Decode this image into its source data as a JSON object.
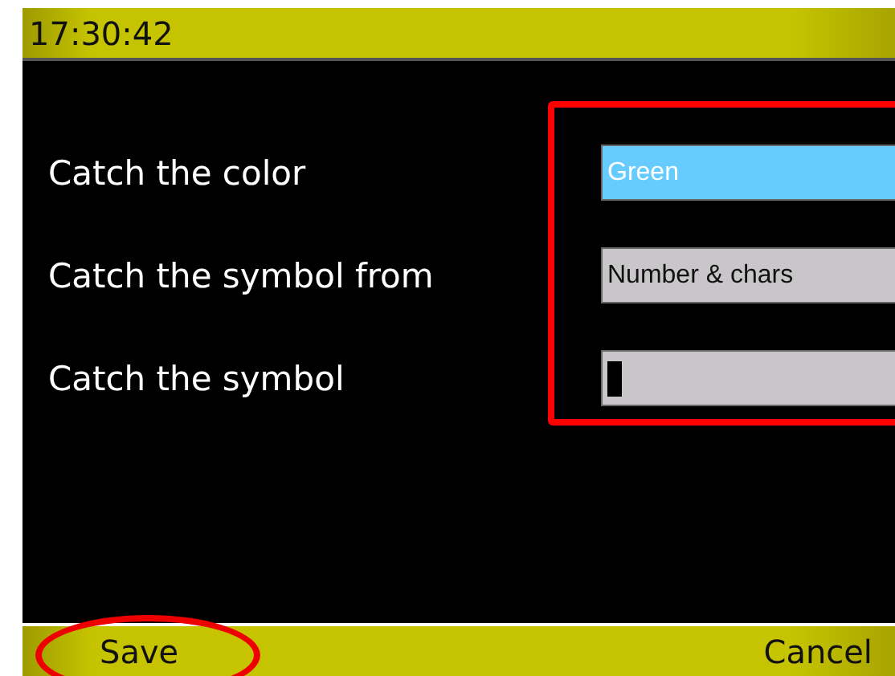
{
  "status_bar": {
    "time": "17:30:42"
  },
  "fields": [
    {
      "label": "Catch the color",
      "kind": "select",
      "value": "Green",
      "selected": true
    },
    {
      "label": "Catch the symbol from",
      "kind": "select",
      "value": "Number & chars",
      "selected": false
    },
    {
      "label": "Catch the symbol",
      "kind": "text",
      "selected": false
    }
  ],
  "softkeys": {
    "left": "Save",
    "right": "Cancel"
  }
}
